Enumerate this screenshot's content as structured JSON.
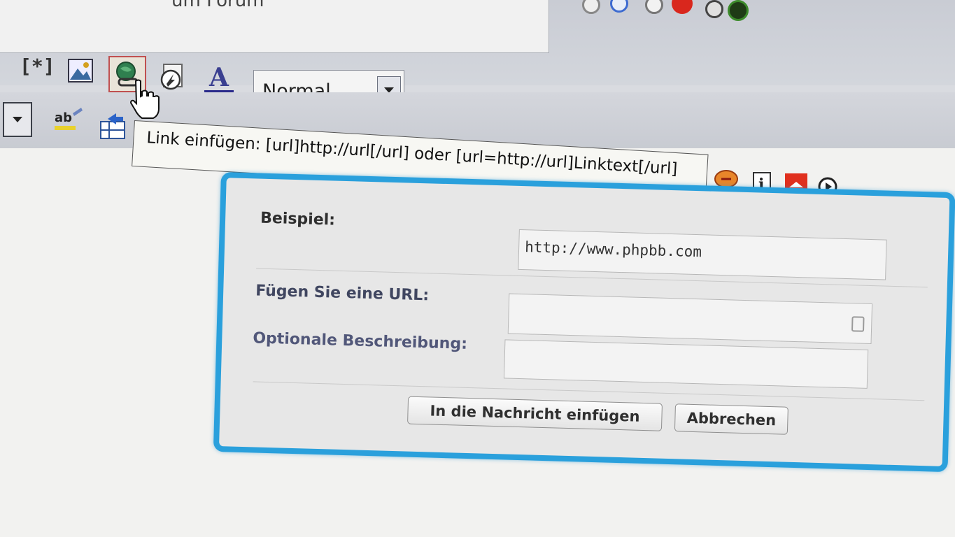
{
  "subject": {
    "value": "um Forum"
  },
  "smilies": [
    {
      "icon": "grey-smiley-icon"
    },
    {
      "icon": "blue-smiley-icon"
    },
    {
      "icon": "grey-smiley-icon"
    },
    {
      "icon": "red-smiley-icon"
    },
    {
      "icon": "grey-smiley-icon"
    },
    {
      "icon": "green-smiley-icon"
    }
  ],
  "toolbar": {
    "list_label": "[*]",
    "font_size_value": "Normal",
    "strike_label": "ab",
    "spell_label": "ab"
  },
  "tooltip": {
    "text": "Link einfügen: [url]http://url[/url] oder [url=http://url]Linktext[/url]"
  },
  "dialog": {
    "example_label": "Beispiel:",
    "example_value": "http://www.phpbb.com",
    "url_label": "Fügen Sie eine URL:",
    "url_value": "",
    "description_label": "Optionale Beschreibung:",
    "description_value": "",
    "insert_button": "In die Nachricht einfügen",
    "cancel_button": "Abbrechen"
  },
  "colors": {
    "dialog_border": "#2aa0dc",
    "url_button_border": "#c05050"
  }
}
